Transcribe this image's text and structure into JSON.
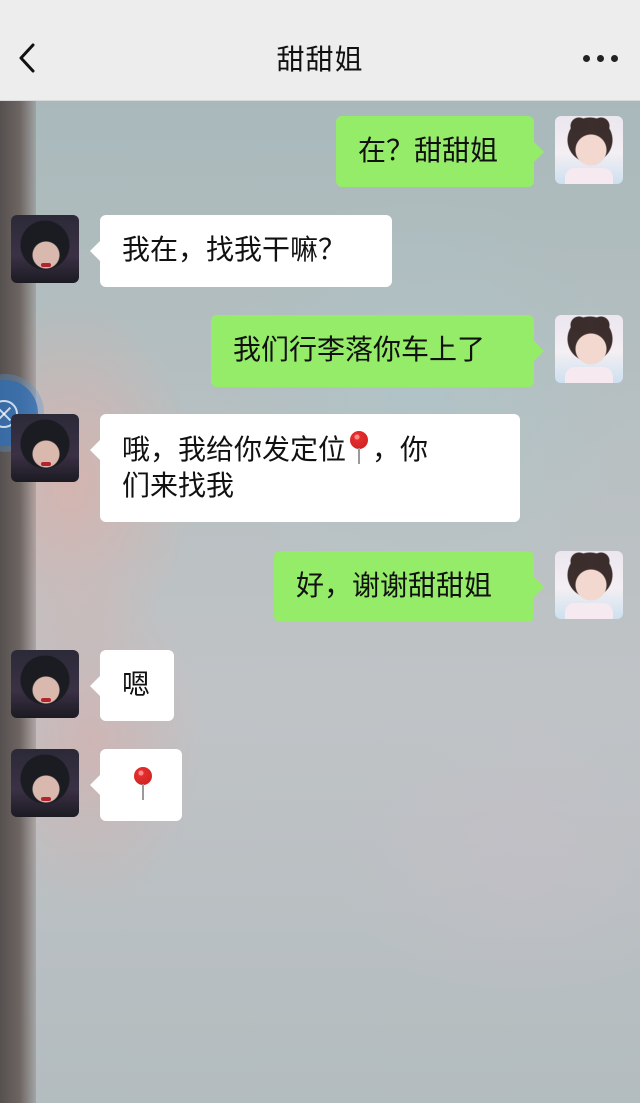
{
  "nav": {
    "title": "甜甜姐"
  },
  "messages": [
    {
      "sender": "me",
      "text": "在？甜甜姐"
    },
    {
      "sender": "them",
      "text": "我在，找我干嘛？"
    },
    {
      "sender": "me",
      "text": "我们行李落你车上了"
    },
    {
      "sender": "them",
      "text_before": "哦，我给你发定位",
      "text_after": "，你",
      "text_line2": "们来找我",
      "icon": "location-pin-emoji"
    },
    {
      "sender": "me",
      "text": "好，谢谢甜甜姐"
    },
    {
      "sender": "them",
      "text": "嗯"
    },
    {
      "sender": "them",
      "icon": "location-pin-emoji"
    }
  ],
  "colors": {
    "nav_bg": "#ededed",
    "my_bubble": "#95ec69",
    "their_bubble": "#ffffff"
  },
  "icons": {
    "back": "chevron-left-icon",
    "more": "more-dots-icon",
    "floating": "floating-ball-icon"
  }
}
